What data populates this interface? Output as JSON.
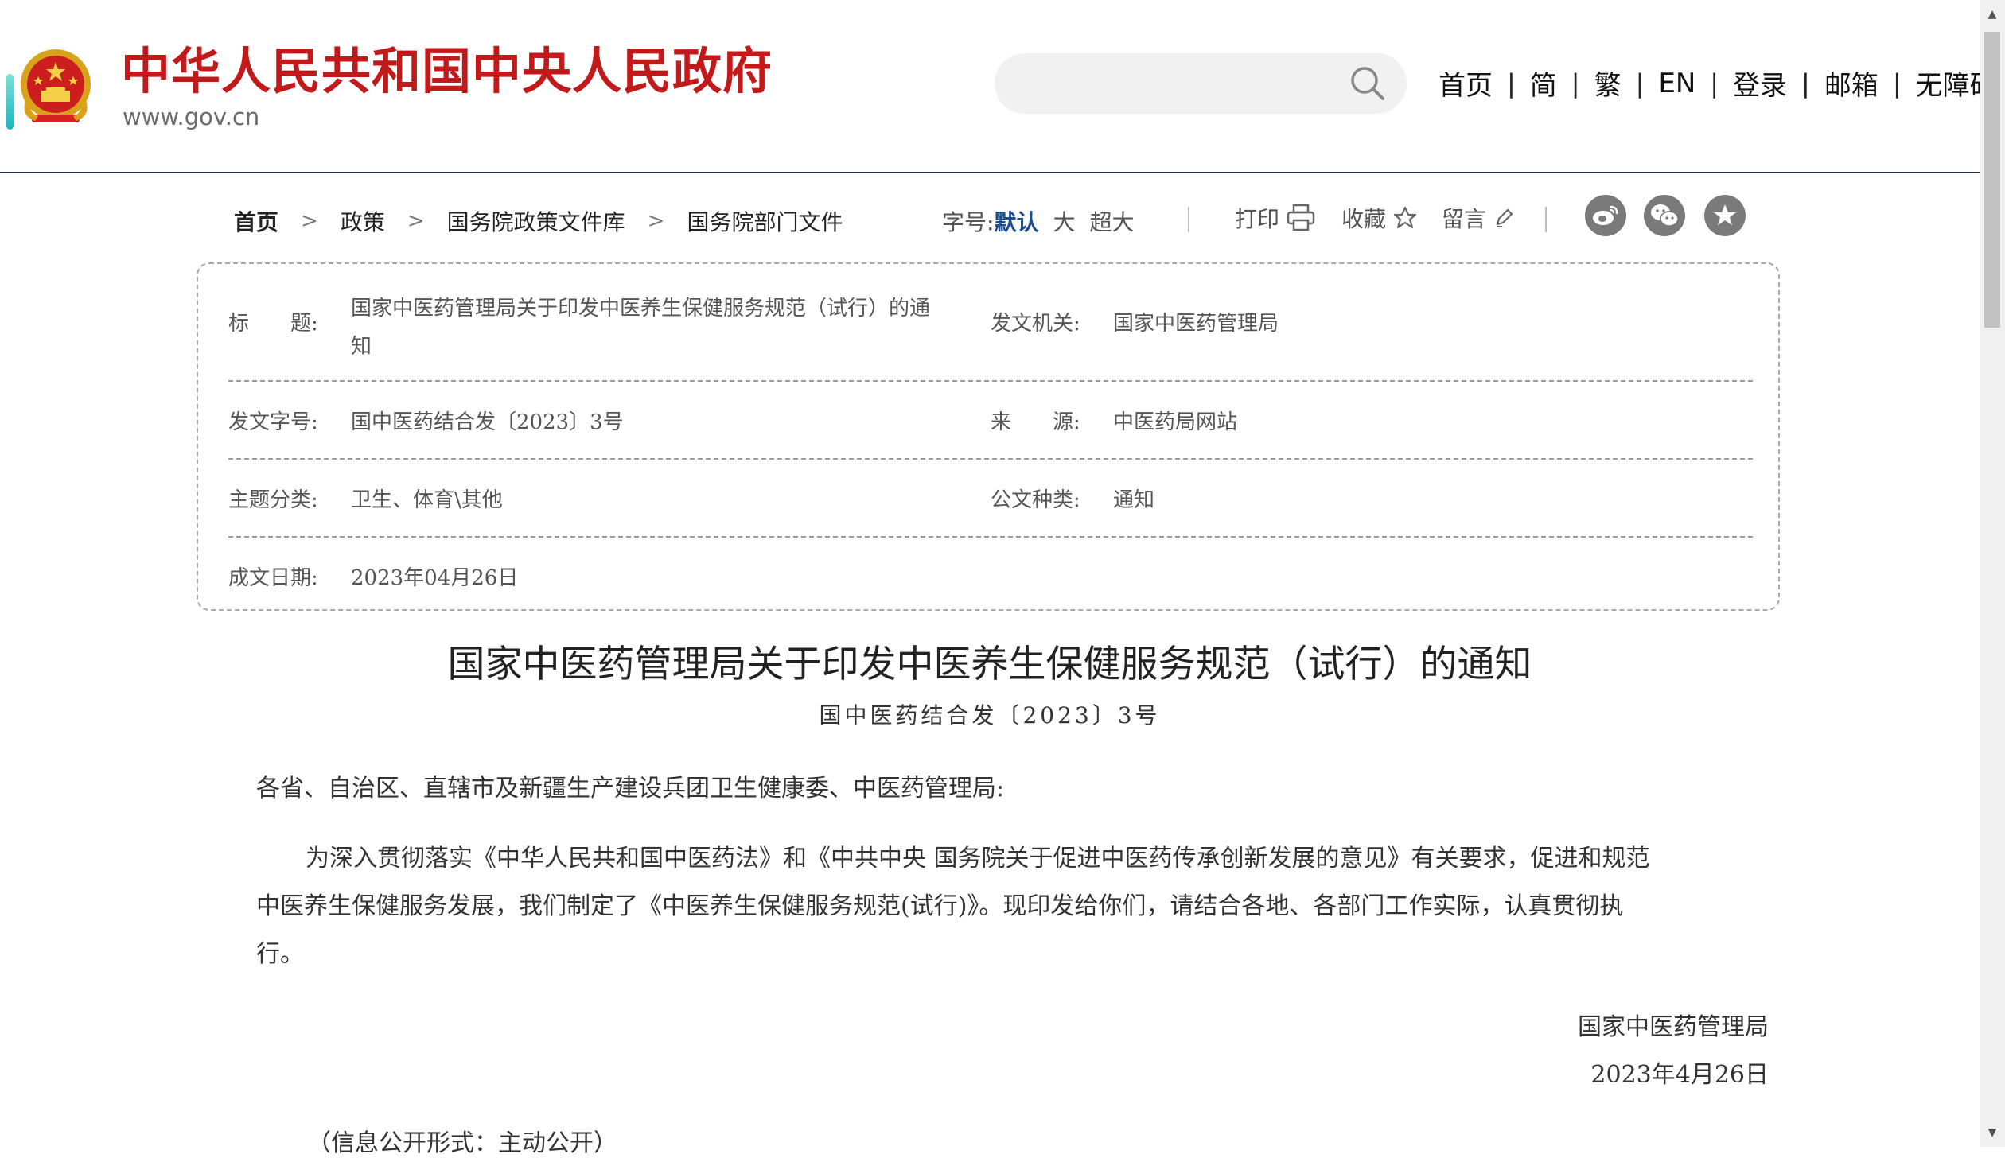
{
  "header": {
    "site_name": "中华人民共和国中央人民政府",
    "domain": "www.gov.cn",
    "search_placeholder": "",
    "nav": [
      "首页",
      "简",
      "繁",
      "EN",
      "登录",
      "邮箱",
      "无障碍"
    ]
  },
  "breadcrumb": [
    "首页",
    "政策",
    "国务院政策文件库",
    "国务院部门文件"
  ],
  "toolbar": {
    "font_size_label": "字号:",
    "font_sizes": [
      "默认",
      "大",
      "超大"
    ],
    "print_label": "打印",
    "favorite_label": "收藏",
    "comment_label": "留言"
  },
  "meta": {
    "title_label": "标　　题:",
    "title_value_line1": "国家中医药管理局关于印发中医养生保健服务规范（试行）的通",
    "title_value_line2": "知",
    "issuer_label": "发文机关:",
    "issuer_value": "国家中医药管理局",
    "doc_no_label": "发文字号:",
    "doc_no_value": "国中医药结合发〔2023〕3号",
    "source_label": "来　　源:",
    "source_value": "中医药局网站",
    "topic_label": "主题分类:",
    "topic_value": "卫生、体育\\其他",
    "doc_type_label": "公文种类:",
    "doc_type_value": "通知",
    "date_label": "成文日期:",
    "date_value": "2023年04月26日"
  },
  "article": {
    "title": "国家中医药管理局关于印发中医养生保健服务规范（试行）的通知",
    "doc_number": "国中医药结合发〔2023〕3号",
    "salutation": "各省、自治区、直辖市及新疆生产建设兵团卫生健康委、中医药管理局:",
    "paragraph_line1": "为深入贯彻落实《中华人民共和国中医药法》和《中共中央 国务院关于促进中医药传承创新发展的意见》有关要求，促进和规范",
    "paragraph_line2": "中医养生保健服务发展，我们制定了《中医养生保健服务规范(试行)》。现印发给你们，请结合各地、各部门工作实际，认真贯彻执",
    "paragraph_line3": "行。",
    "sign_org": "国家中医药管理局",
    "sign_date": "2023年4月26日",
    "disclosure": "（信息公开形式：主动公开）"
  },
  "colors": {
    "brand_red": "#c21a1a",
    "active_blue": "#1d4f8f",
    "header_rule": "#1e2c3a"
  }
}
